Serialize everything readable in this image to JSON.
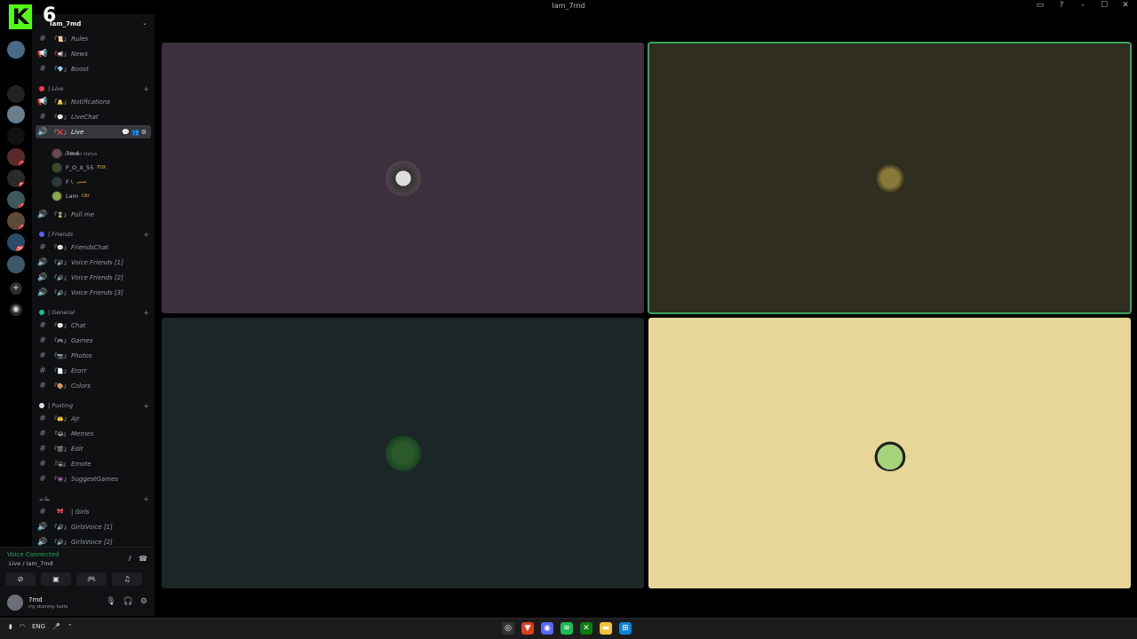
{
  "window": {
    "title": "Iam_7md"
  },
  "watermark": {
    "letter": "K",
    "number": "6"
  },
  "server": {
    "name": "Iam_7md"
  },
  "servers": [
    {
      "badge": ""
    },
    {
      "badge": ""
    },
    {
      "badge": ""
    },
    {
      "badge": ""
    },
    {
      "badge": "3"
    },
    {
      "badge": "53"
    },
    {
      "badge": "4"
    },
    {
      "badge": "1"
    },
    {
      "badge": "396"
    },
    {
      "badge": ""
    }
  ],
  "channels": {
    "top": [
      {
        "icon": "#",
        "label": "Rules"
      },
      {
        "icon": "📢",
        "label": "News"
      },
      {
        "icon": "#",
        "label": "Boost"
      }
    ],
    "cat_live": "| Live",
    "live": [
      {
        "icon": "📢",
        "label": "Notifications"
      },
      {
        "icon": "#",
        "label": "LiveChat"
      },
      {
        "icon": "🔊",
        "label": "Live"
      }
    ],
    "live_status": "Set a channel status",
    "voice_users": [
      {
        "name": "7md",
        "tag": ""
      },
      {
        "name": "F_O_X_55",
        "tag": "FOX"
      },
      {
        "name": "F \\",
        "tag": "شمي"
      },
      {
        "name": "Lam",
        "tag": "Ultr"
      }
    ],
    "pullme": {
      "icon": "🔊",
      "label": "Pull me"
    },
    "cat_friends": "| Friends",
    "friends": [
      {
        "icon": "#",
        "label": "FriendsChat"
      },
      {
        "icon": "🔊",
        "label": "Voice Friends [1]"
      },
      {
        "icon": "🔊",
        "label": "Voice Friends [2]"
      },
      {
        "icon": "🔊",
        "label": "Voice Friends [3]"
      }
    ],
    "cat_general": "| General",
    "general": [
      {
        "icon": "#",
        "label": "Chat"
      },
      {
        "icon": "#",
        "label": "Games"
      },
      {
        "icon": "#",
        "label": "Photos"
      },
      {
        "icon": "#",
        "label": "Erorr"
      },
      {
        "icon": "#",
        "label": "Colors"
      }
    ],
    "cat_posting": "| Posting",
    "posting": [
      {
        "icon": "#",
        "label": "Ajr"
      },
      {
        "icon": "#",
        "label": "Memes"
      },
      {
        "icon": "#",
        "label": "Edit"
      },
      {
        "icon": "#",
        "label": "Emote"
      },
      {
        "icon": "#",
        "label": "SuggestGames"
      }
    ],
    "cat_girls": "بنات",
    "girls": [
      {
        "icon": "#",
        "label": "| Girls"
      },
      {
        "icon": "🔊",
        "label": "GirlsVoice [1]"
      },
      {
        "icon": "🔊",
        "label": "GirlsVoice [2]"
      }
    ]
  },
  "voice": {
    "connected": "Voice Connected",
    "location": "Live / Iam_7md"
  },
  "user": {
    "name": "7md",
    "status": "my stummy hurts"
  },
  "taskbar": {
    "lang": "ENG"
  },
  "colors": {
    "tile1": "#3d2f3d",
    "tile2": "#302d21",
    "tile3": "#1a2726",
    "tile4": "#e8d699",
    "speaking": "#3ba55c"
  }
}
